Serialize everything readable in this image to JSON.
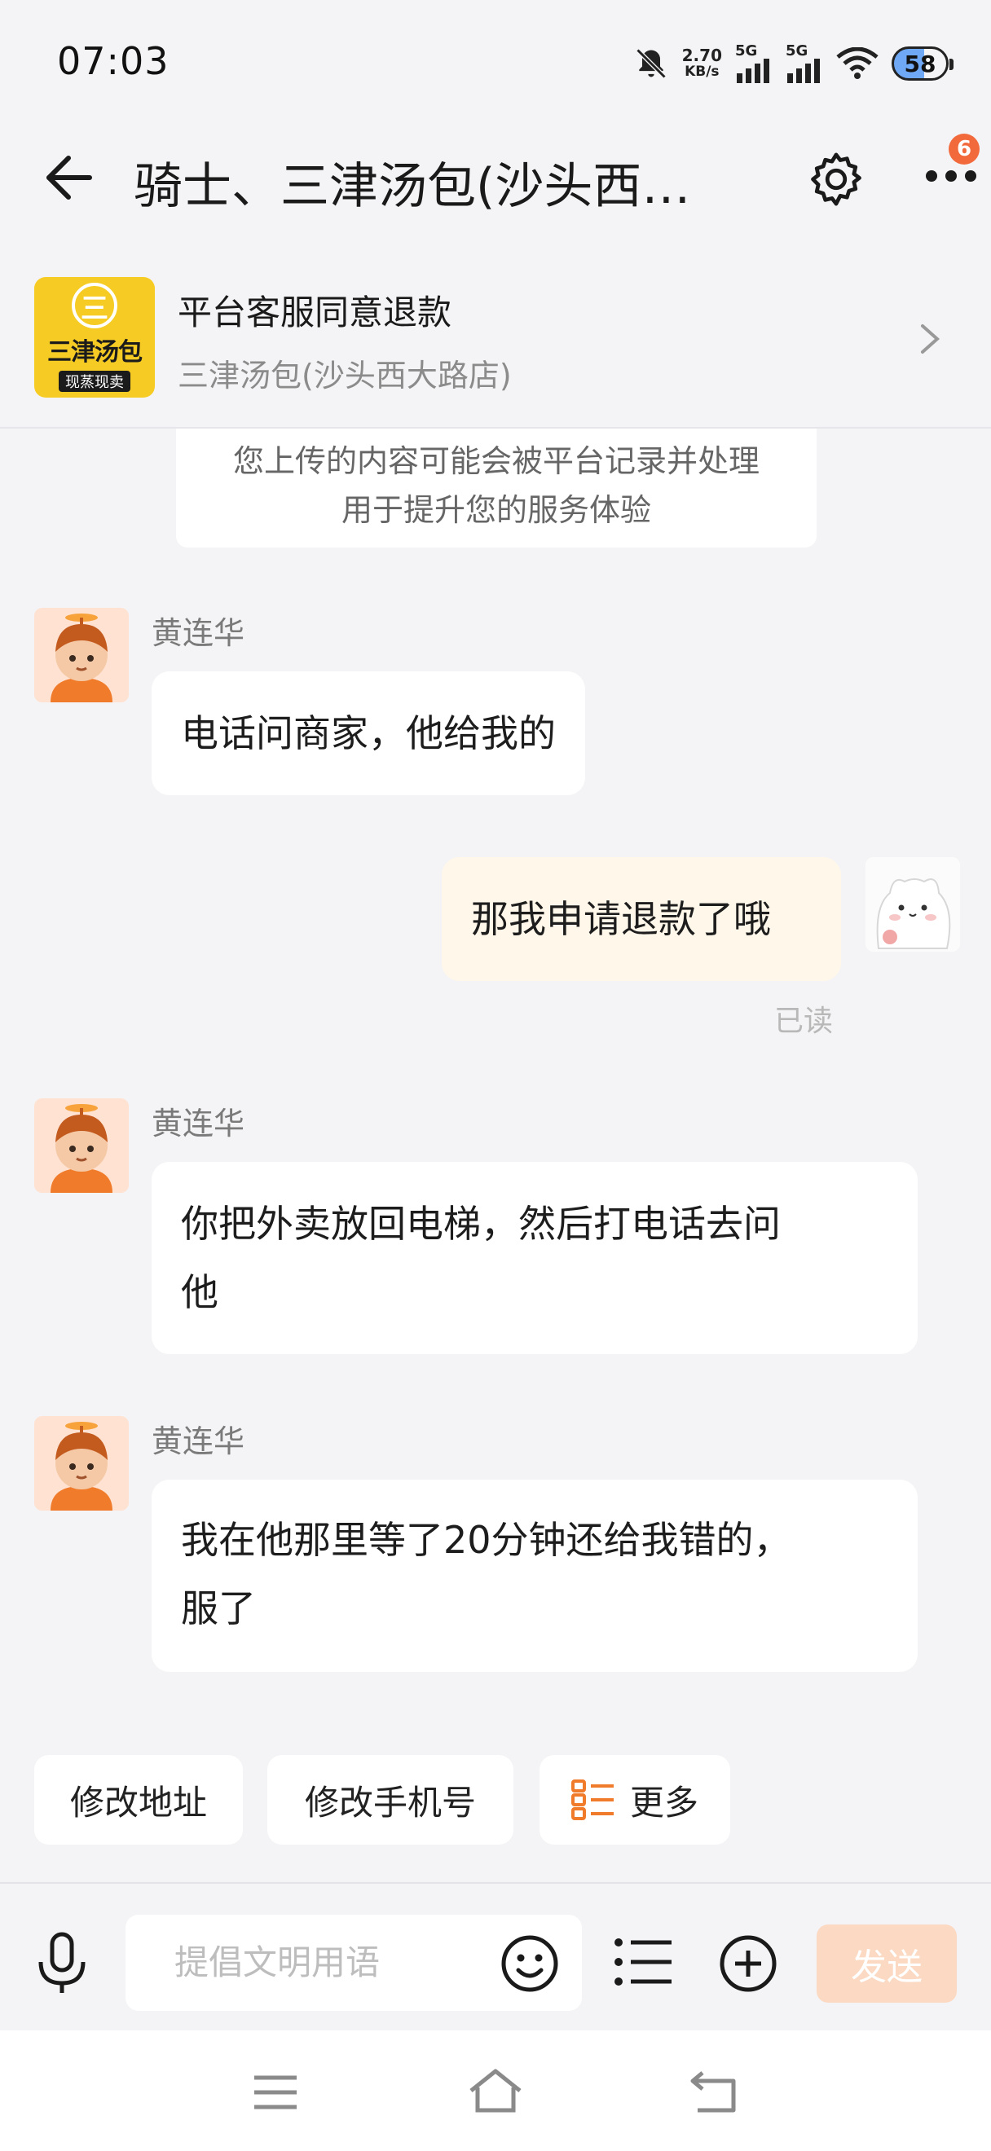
{
  "status_bar": {
    "time": "07:03",
    "net_speed_value": "2.70",
    "net_speed_unit": "KB/s",
    "signal_1": "5G",
    "signal_2": "5G",
    "battery": "58"
  },
  "header": {
    "title": "骑士、三津汤包(沙头西…",
    "more_badge": "6"
  },
  "order": {
    "logo_main": "三津汤包",
    "logo_sub": "现蒸现卖",
    "logo_mark": "三",
    "status": "平台客服同意退款",
    "store": "三津汤包(沙头西大路店)"
  },
  "notice": {
    "line1": "您上传的内容可能会被平台记录并处理",
    "line2": "用于提升您的服务体验"
  },
  "messages": [
    {
      "sender": "黄连华",
      "text": "电话问商家，他给我的"
    },
    {
      "sender": "self",
      "text": "那我申请退款了哦",
      "status": "已读"
    },
    {
      "sender": "黄连华",
      "line1": "你把外卖放回电梯，然后打电话去问",
      "line2": "他"
    },
    {
      "sender": "黄连华",
      "line1": "我在他那里等了20分钟还给我错的，",
      "line2": "服了"
    }
  ],
  "quick_actions": {
    "change_address": "修改地址",
    "change_phone": "修改手机号",
    "more": "更多"
  },
  "input": {
    "placeholder": "提倡文明用语",
    "send": "发送"
  },
  "colors": {
    "accent": "#f26a3c",
    "self_bubble": "#fff7e9",
    "send_disabled": "#fbd9c2",
    "logo_yellow": "#f6cc24"
  }
}
